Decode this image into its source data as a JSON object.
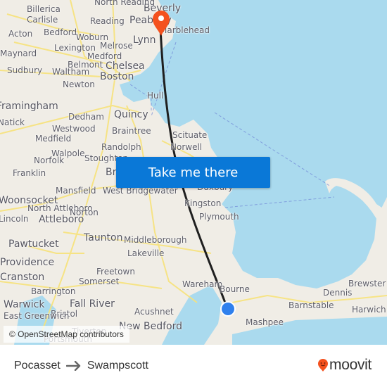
{
  "map": {
    "places": [
      {
        "name": "Beverly",
        "big": true
      },
      {
        "name": "Billerica"
      },
      {
        "name": "North Reading"
      },
      {
        "name": "Carlisle"
      },
      {
        "name": "Reading"
      },
      {
        "name": "Peabody",
        "big": true
      },
      {
        "name": "Marblehead"
      },
      {
        "name": "Acton"
      },
      {
        "name": "Bedford"
      },
      {
        "name": "Woburn"
      },
      {
        "name": "Lynn",
        "big": true
      },
      {
        "name": "Lexington"
      },
      {
        "name": "Melrose"
      },
      {
        "name": "Maynard"
      },
      {
        "name": "Medford"
      },
      {
        "name": "Belmont"
      },
      {
        "name": "Chelsea",
        "big": true
      },
      {
        "name": "Sudbury"
      },
      {
        "name": "Waltham"
      },
      {
        "name": "Boston",
        "big": true
      },
      {
        "name": "Newton"
      },
      {
        "name": "Hull"
      },
      {
        "name": "Framingham",
        "big": true
      },
      {
        "name": "Dedham"
      },
      {
        "name": "Quincy",
        "big": true
      },
      {
        "name": "Natick"
      },
      {
        "name": "Westwood"
      },
      {
        "name": "Braintree"
      },
      {
        "name": "Scituate"
      },
      {
        "name": "Medfield"
      },
      {
        "name": "Norwell"
      },
      {
        "name": "Walpole"
      },
      {
        "name": "Randolph"
      },
      {
        "name": "Norfolk"
      },
      {
        "name": "Stoughton"
      },
      {
        "name": "Franklin"
      },
      {
        "name": "Brockton",
        "big": true
      },
      {
        "name": "Duxbury"
      },
      {
        "name": "Mansfield"
      },
      {
        "name": "West Bridgewater"
      },
      {
        "name": "Woonsocket",
        "big": true
      },
      {
        "name": "North Attleboro"
      },
      {
        "name": "Norton"
      },
      {
        "name": "Kingston"
      },
      {
        "name": "Lincoln"
      },
      {
        "name": "Attleboro",
        "big": true
      },
      {
        "name": "Plymouth"
      },
      {
        "name": "Pawtucket",
        "big": true
      },
      {
        "name": "Taunton",
        "big": true
      },
      {
        "name": "Middleborough"
      },
      {
        "name": "Lakeville"
      },
      {
        "name": "Providence",
        "big": true
      },
      {
        "name": "Freetown"
      },
      {
        "name": "Cranston",
        "big": true
      },
      {
        "name": "Somerset"
      },
      {
        "name": "Wareham"
      },
      {
        "name": "Brewster"
      },
      {
        "name": "Barrington"
      },
      {
        "name": "Bourne"
      },
      {
        "name": "Dennis"
      },
      {
        "name": "Warwick",
        "big": true
      },
      {
        "name": "Fall River",
        "big": true
      },
      {
        "name": "Barnstable"
      },
      {
        "name": "Harwich"
      },
      {
        "name": "Bristol"
      },
      {
        "name": "Acushnet"
      },
      {
        "name": "East Greenwich"
      },
      {
        "name": "Mashpee"
      },
      {
        "name": "New Bedford",
        "big": true
      },
      {
        "name": "Tiverton"
      },
      {
        "name": "Portsmouth"
      }
    ],
    "destination_pin": {
      "label": "Swampscott",
      "color": "#f4511e"
    },
    "origin_marker": {
      "label": "Pocasset",
      "color": "#2f80ed"
    },
    "route_color": "#1f1f1f",
    "cta_label": "Take me there",
    "attribution": "© OpenStreetMap contributors"
  },
  "footer": {
    "origin": "Pocasset",
    "destination": "Swampscott",
    "arrow_icon": "arrow-right-icon",
    "brand": "moovit",
    "brand_color": "#f4511e"
  }
}
